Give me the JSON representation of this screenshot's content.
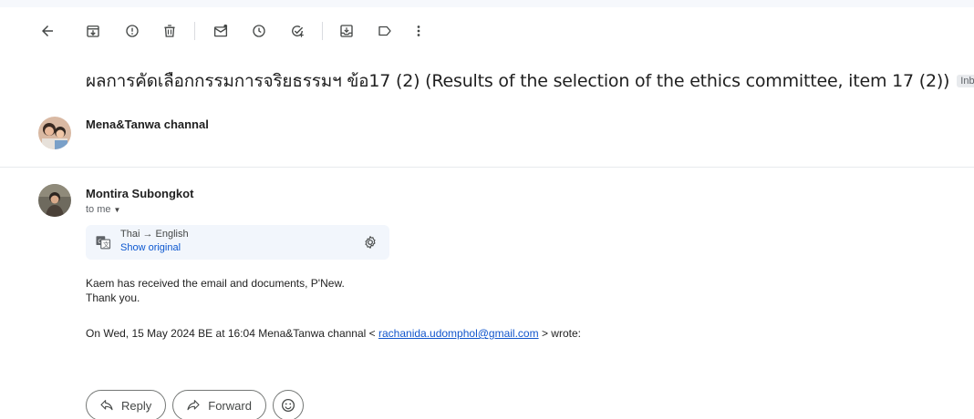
{
  "toolbar": {
    "icons": [
      "back-arrow-icon",
      "archive-icon",
      "report-spam-icon",
      "delete-icon",
      "mark-unread-icon",
      "snooze-icon",
      "add-to-tasks-icon",
      "move-to-icon",
      "labels-icon",
      "more-vert-icon"
    ]
  },
  "subject": "ผลการคัดเลือกกรรมการจริยธรรมฯ ข้อ17 (2) (Results of the selection of the ethics committee, item 17 (2))",
  "label_chip": {
    "text": "Inbox",
    "close": "×"
  },
  "thread": [
    {
      "sender": "Mena&Tanwa channal"
    },
    {
      "sender": "Montira Subongkot",
      "to": "to me",
      "translate": {
        "languages": "Thai → English",
        "show_original": "Show original"
      },
      "body": {
        "line1": "Kaem has received the email and documents, P'New.",
        "line2": "Thank you.",
        "quote_prefix": "On Wed, 15 May 2024 BE at 16:04 Mena&Tanwa channal <",
        "quote_email": "rachanida.udomphol@gmail.com",
        "quote_suffix": "> wrote:"
      }
    }
  ],
  "actions": {
    "reply": "Reply",
    "forward": "Forward"
  },
  "colors": {
    "link": "#1155cc",
    "show_original": "#0b57d0",
    "translate_bg": "#f2f6fc"
  }
}
